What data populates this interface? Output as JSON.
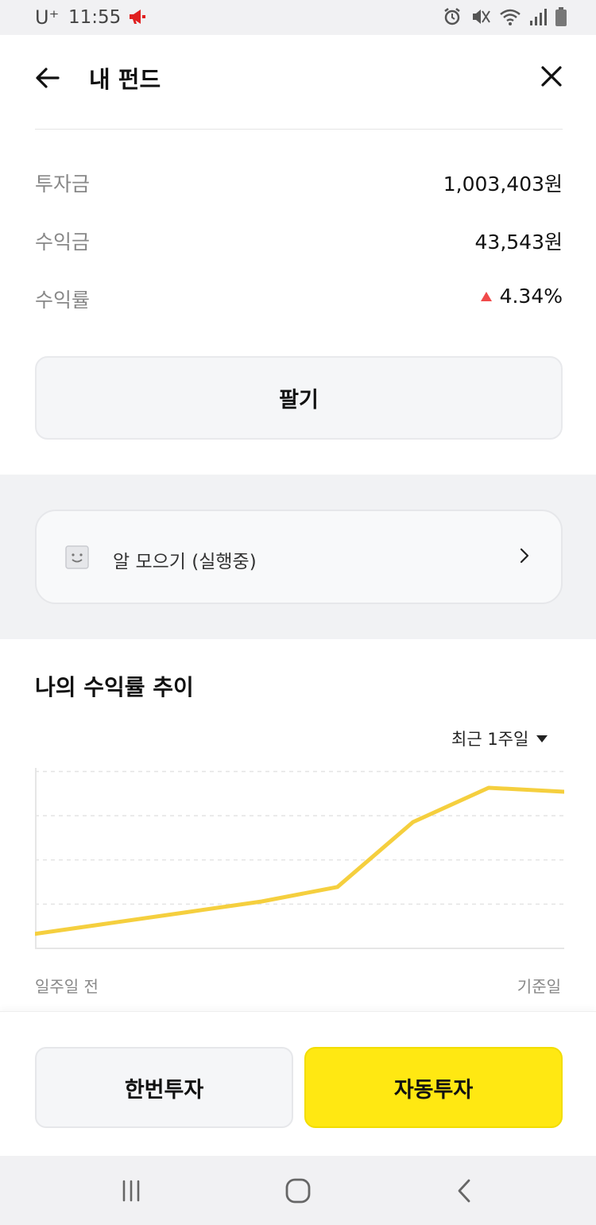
{
  "status_bar": {
    "carrier": "U⁺",
    "time": "11:55",
    "icons": [
      "megaphone-icon",
      "alarm-icon",
      "mute-icon",
      "wifi-icon",
      "signal-icon",
      "battery-icon"
    ]
  },
  "header": {
    "title": "내 펀드",
    "back_icon": "arrow-left-icon",
    "close_icon": "close-icon"
  },
  "summary": {
    "invest_label": "투자금",
    "invest_value": "1,003,403원",
    "profit_label": "수익금",
    "profit_value": "43,543원",
    "rate_label": "수익률",
    "rate_value": "4.34%"
  },
  "sell_label": "팔기",
  "auto_saving": {
    "label": "알 모으기 (실행중)",
    "icon": "smile-icon"
  },
  "trend": {
    "title": "나의 수익률 추이",
    "period": "최근 1주일"
  },
  "chart_data": {
    "type": "line",
    "x": [
      "일주일 전",
      "",
      "",
      "",
      "",
      "",
      "",
      "기준일"
    ],
    "values": [
      0.4,
      0.7,
      1.0,
      1.3,
      1.7,
      3.5,
      4.45,
      4.34
    ],
    "ylim": [
      0,
      5
    ],
    "grid": true,
    "xlabel_start": "일주일 전",
    "xlabel_end": "기준일",
    "line_color": "#f5cf3e"
  },
  "actions": {
    "once_label": "한번투자",
    "auto_label": "자동투자"
  },
  "colors": {
    "accent_yellow": "#ffe812",
    "up_red": "#f04a4a"
  },
  "nav": {
    "icons": [
      "recent-apps-icon",
      "home-icon",
      "back-icon"
    ]
  }
}
